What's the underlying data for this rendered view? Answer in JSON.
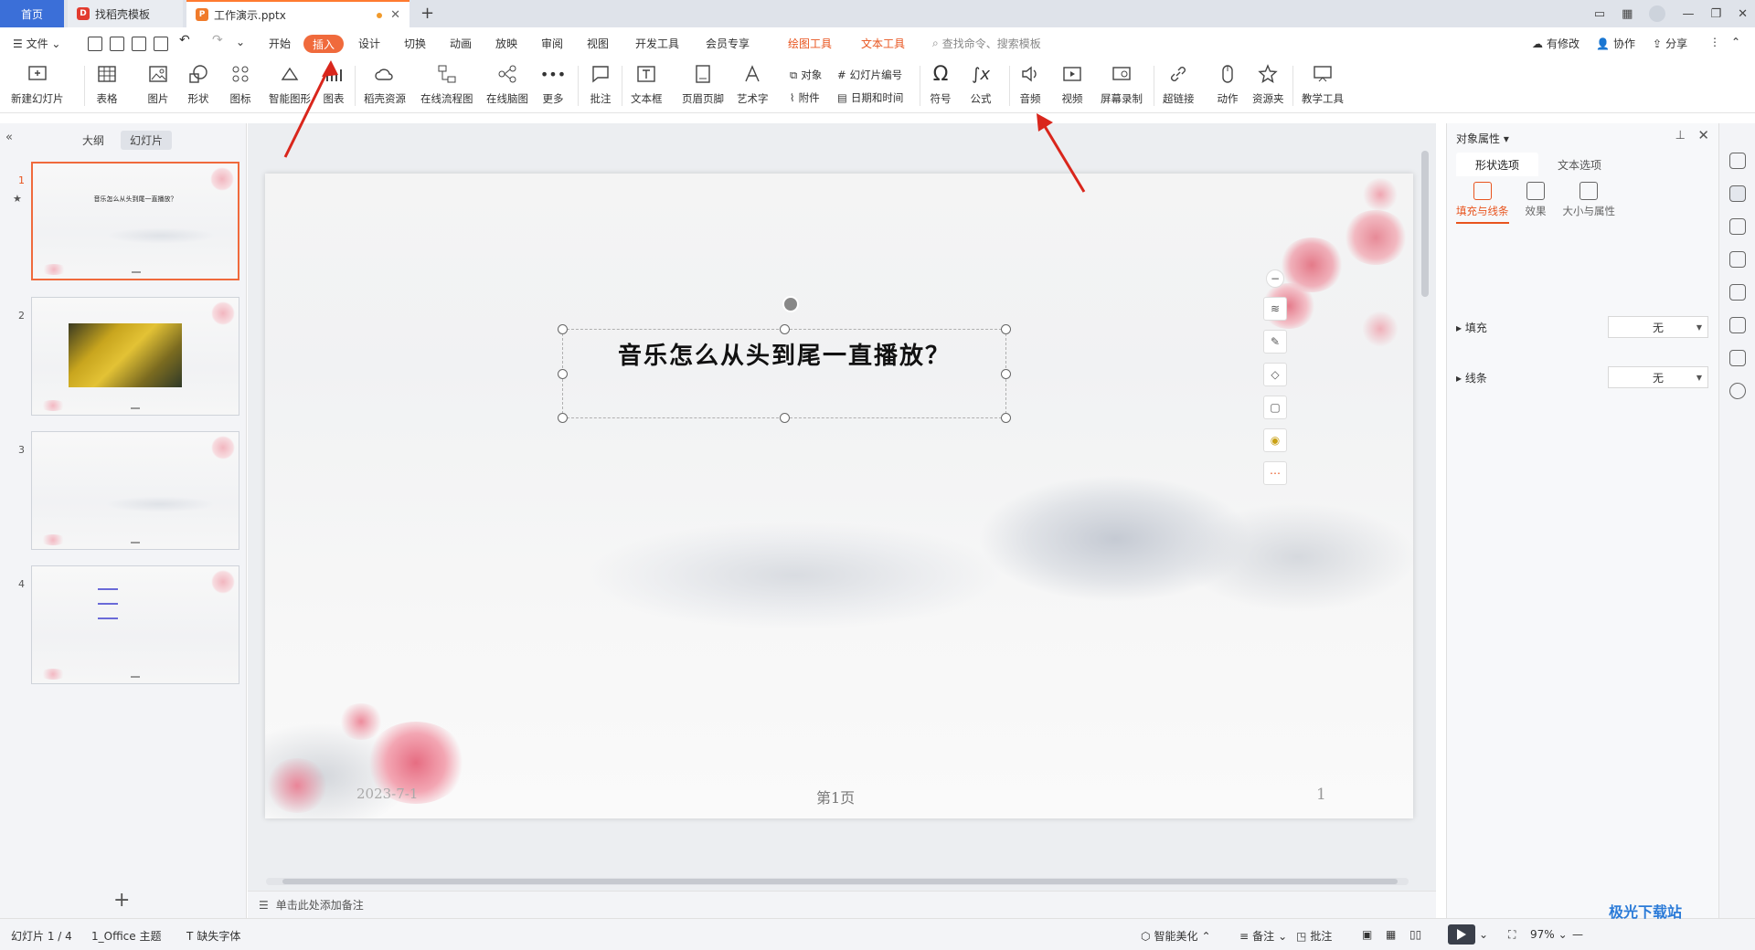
{
  "tabs": {
    "home": "首页",
    "template": "找稻壳模板",
    "doc": "工作演示.pptx"
  },
  "menu": {
    "file": "文件",
    "items": [
      "开始",
      "插入",
      "设计",
      "切换",
      "动画",
      "放映",
      "审阅",
      "视图",
      "开发工具",
      "会员专享"
    ],
    "context": [
      "绘图工具",
      "文本工具"
    ],
    "search": "查找命令、搜索模板",
    "right": {
      "changes": "有修改",
      "collab": "协作",
      "share": "分享"
    }
  },
  "ribbon": {
    "new_slide": "新建幻灯片",
    "table": "表格",
    "picture": "图片",
    "shape": "形状",
    "icon": "图标",
    "smartart": "智能图形",
    "chart": "图表",
    "daoke": "稻壳资源",
    "flowchart": "在线流程图",
    "mindmap": "在线脑图",
    "more": "更多",
    "comment": "批注",
    "textbox": "文本框",
    "header_footer": "页眉页脚",
    "wordart": "艺术字",
    "object": "对象",
    "attachment": "附件",
    "slide_number": "幻灯片编号",
    "datetime": "日期和时间",
    "symbol": "符号",
    "formula": "公式",
    "audio": "音频",
    "video": "视频",
    "screen_record": "屏幕录制",
    "hyperlink": "超链接",
    "action": "动作",
    "resource": "资源夹",
    "teaching": "教学工具"
  },
  "left_panel": {
    "tab_outline": "大纲",
    "tab_slides": "幻灯片",
    "slides": [
      {
        "num": "1",
        "text": "音乐怎么从头到尾一直播放？"
      },
      {
        "num": "2",
        "text": ""
      },
      {
        "num": "3",
        "text": ""
      },
      {
        "num": "4",
        "text": ""
      }
    ]
  },
  "slide": {
    "title": "音乐怎么从头到尾一直播放？",
    "date": "2023-7-1",
    "page_label": "第1页",
    "number": "1"
  },
  "notes_placeholder": "单击此处添加备注",
  "right_panel": {
    "title": "对象属性",
    "tabs": [
      "形状选项",
      "文本选项"
    ],
    "subtabs": [
      "填充与线条",
      "效果",
      "大小与属性"
    ],
    "fill_label": "填充",
    "fill_value": "无",
    "line_label": "线条",
    "line_value": "无"
  },
  "status": {
    "slide_count": "幻灯片 1 / 4",
    "theme": "1_Office 主题",
    "missing_font": "缺失字体",
    "smart_beautify": "智能美化",
    "notes": "备注",
    "comments": "批注",
    "zoom": "97%"
  },
  "watermark": "极光下载站",
  "colors": {
    "accent": "#f06a3c",
    "home_tab": "#3b6fd8",
    "arrow": "#d9261c"
  }
}
